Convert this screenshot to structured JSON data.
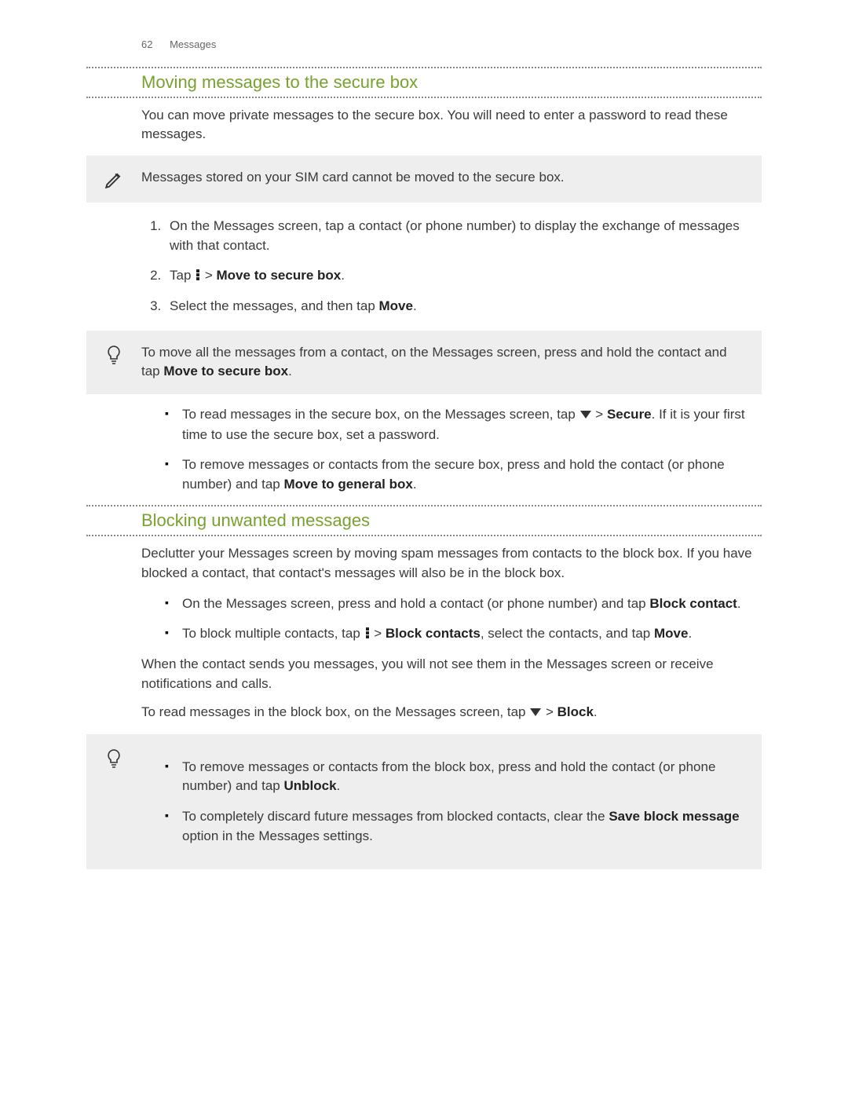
{
  "header": {
    "page_number": "62",
    "section": "Messages"
  },
  "section1": {
    "title": "Moving messages to the secure box",
    "intro": "You can move private messages to the secure box. You will need to enter a password to read these messages.",
    "note": "Messages stored on your SIM card cannot be moved to the secure box.",
    "steps": {
      "s1": "On the Messages screen, tap a contact (or phone number) to display the exchange of messages with that contact.",
      "s2_a": "Tap ",
      "s2_b": " > ",
      "s2_bold": "Move to secure box",
      "s2_c": ".",
      "s3_a": "Select the messages, and then tap ",
      "s3_bold": "Move",
      "s3_b": "."
    },
    "tip_a": "To move all the messages from a contact, on the Messages screen, press and hold the contact and tap ",
    "tip_bold": "Move to secure box",
    "tip_b": ".",
    "bullets": {
      "b1_a": "To read messages in the secure box, on the Messages screen, tap ",
      "b1_b": " > ",
      "b1_bold": "Secure",
      "b1_c": ". If it is your first time to use the secure box, set a password.",
      "b2_a": "To remove messages or contacts from the secure box, press and hold the contact (or phone number) and tap ",
      "b2_bold": "Move to general box",
      "b2_b": "."
    }
  },
  "section2": {
    "title": "Blocking unwanted messages",
    "intro": "Declutter your Messages screen by moving spam messages from contacts to the block box. If you have blocked a contact, that contact's messages will also be in the block box.",
    "bullets": {
      "b1_a": "On the Messages screen, press and hold a contact (or phone number) and tap ",
      "b1_bold": "Block contact",
      "b1_b": ".",
      "b2_a": "To block multiple contacts, tap ",
      "b2_b": " > ",
      "b2_bold": "Block contacts",
      "b2_c": ", select the contacts, and tap ",
      "b2_bold2": "Move",
      "b2_d": "."
    },
    "para2": "When the contact sends you messages, you will not see them in the Messages screen or receive notifications and calls.",
    "para3_a": "To read messages in the block box, on the Messages screen, tap ",
    "para3_b": " > ",
    "para3_bold": "Block",
    "para3_c": ".",
    "tip_bullets": {
      "b1_a": "To remove messages or contacts from the block box, press and hold the contact (or phone number) and tap ",
      "b1_bold": "Unblock",
      "b1_b": ".",
      "b2_a": "To completely discard future messages from blocked contacts, clear the ",
      "b2_bold": "Save block message",
      "b2_b": " option in the Messages settings."
    }
  }
}
